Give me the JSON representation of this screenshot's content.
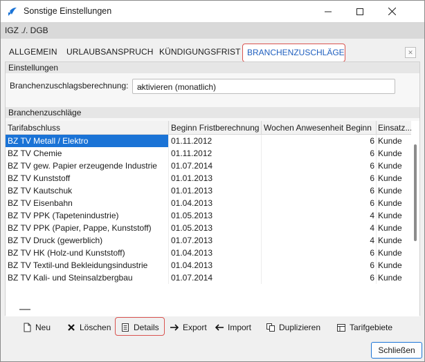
{
  "window": {
    "title": "Sonstige Einstellungen"
  },
  "subheader": {
    "text": "IGZ ./. DGB"
  },
  "tabs": [
    {
      "label": "ALLGEMEIN"
    },
    {
      "label": "URLAUBSANSPRUCH"
    },
    {
      "label": "KÜNDIGUNGSFRIST"
    },
    {
      "label": "BRANCHENZUSCHLÄGE",
      "active": true
    }
  ],
  "settings": {
    "section_label": "Einstellungen",
    "field_label": "Branchenzuschlagsberechnung:",
    "field_value": "aktivieren (monatlich)"
  },
  "table": {
    "section_label": "Branchenzuschläge",
    "columns": [
      "Tarifabschluss",
      "Beginn Fristberechnung",
      "Wochen Anwesenheit Beginn",
      "Einsatz..."
    ],
    "rows": [
      [
        "BZ TV Metall / Elektro",
        "01.11.2012",
        "6",
        "Kunde"
      ],
      [
        "BZ TV Chemie",
        "01.11.2012",
        "6",
        "Kunde"
      ],
      [
        "BZ TV gew. Papier erzeugende Industrie",
        "01.07.2014",
        "6",
        "Kunde"
      ],
      [
        "BZ TV Kunststoff",
        "01.01.2013",
        "6",
        "Kunde"
      ],
      [
        "BZ TV Kautschuk",
        "01.01.2013",
        "6",
        "Kunde"
      ],
      [
        "BZ TV Eisenbahn",
        "01.04.2013",
        "6",
        "Kunde"
      ],
      [
        "BZ TV PPK (Tapetenindustrie)",
        "01.05.2013",
        "4",
        "Kunde"
      ],
      [
        "BZ TV PPK (Papier, Pappe, Kunststoff)",
        "01.05.2013",
        "4",
        "Kunde"
      ],
      [
        "BZ TV Druck (gewerblich)",
        "01.07.2013",
        "4",
        "Kunde"
      ],
      [
        "BZ TV HK (Holz-und Kunststoff)",
        "01.04.2013",
        "6",
        "Kunde"
      ],
      [
        "BZ TV Textil-und Bekleidungsindustrie",
        "01.04.2013",
        "6",
        "Kunde"
      ],
      [
        "BZ TV Kali- und Steinsalzbergbau",
        "01.07.2014",
        "6",
        "Kunde"
      ]
    ]
  },
  "toolbar": {
    "new": "Neu",
    "delete": "Löschen",
    "details": "Details",
    "export": "Export",
    "import": "Import",
    "duplicate": "Duplizieren",
    "tariff_areas": "Tarifgebiete"
  },
  "footer": {
    "close_label": "Schließen"
  },
  "colors": {
    "accent": "#1a73d6",
    "highlight": "#d9534f",
    "active_tab": "#1f5fbf"
  }
}
